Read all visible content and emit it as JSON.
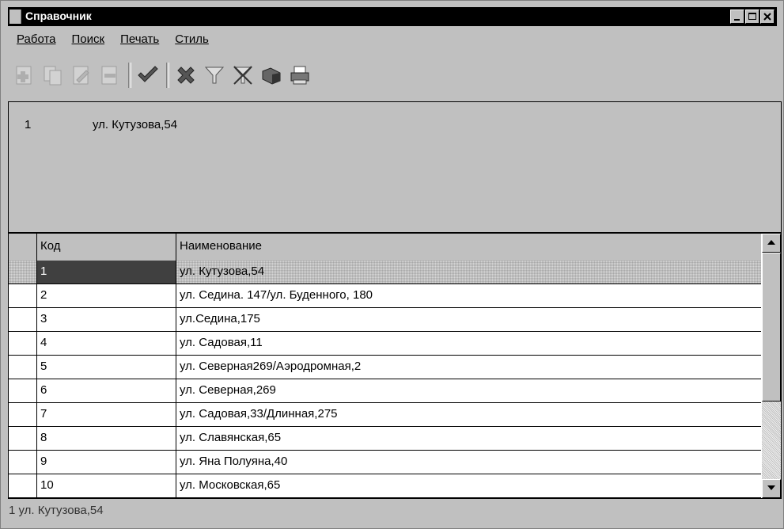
{
  "window": {
    "title": "Справочник"
  },
  "menu": [
    "Работа",
    "Поиск",
    "Печать",
    "Стиль"
  ],
  "toolbar": [
    {
      "icon": "add-record-icon",
      "enabled": false
    },
    {
      "icon": "copy-record-icon",
      "enabled": false
    },
    {
      "icon": "edit-record-icon",
      "enabled": false
    },
    {
      "icon": "delete-record-icon",
      "enabled": false
    },
    {
      "icon": "confirm-check-icon",
      "enabled": true
    },
    {
      "icon": "cancel-x-icon",
      "enabled": true
    },
    {
      "icon": "filter-icon",
      "enabled": true
    },
    {
      "icon": "clear-filter-icon",
      "enabled": true
    },
    {
      "icon": "export-icon",
      "enabled": true
    },
    {
      "icon": "print-icon",
      "enabled": true
    }
  ],
  "detail": {
    "code": "1",
    "name": "ул. Кутузова,54"
  },
  "grid": {
    "headers": {
      "code": "Код",
      "name": "Наименование"
    },
    "rows": [
      {
        "code": "1",
        "name": "ул. Кутузова,54",
        "selected": true
      },
      {
        "code": "2",
        "name": "ул. Седина. 147/ул. Буденного, 180"
      },
      {
        "code": "3",
        "name": "ул.Седина,175"
      },
      {
        "code": "4",
        "name": "ул. Садовая,11"
      },
      {
        "code": "5",
        "name": "ул. Северная269/Аэродромная,2"
      },
      {
        "code": "6",
        "name": "ул. Северная,269"
      },
      {
        "code": "7",
        "name": "ул. Садовая,33/Длинная,275"
      },
      {
        "code": "8",
        "name": "ул. Славянская,65"
      },
      {
        "code": "9",
        "name": "ул. Яна Полуяна,40"
      },
      {
        "code": "10",
        "name": "ул. Московская,65"
      }
    ]
  },
  "status": {
    "text": "1 ул. Кутузова,54"
  }
}
